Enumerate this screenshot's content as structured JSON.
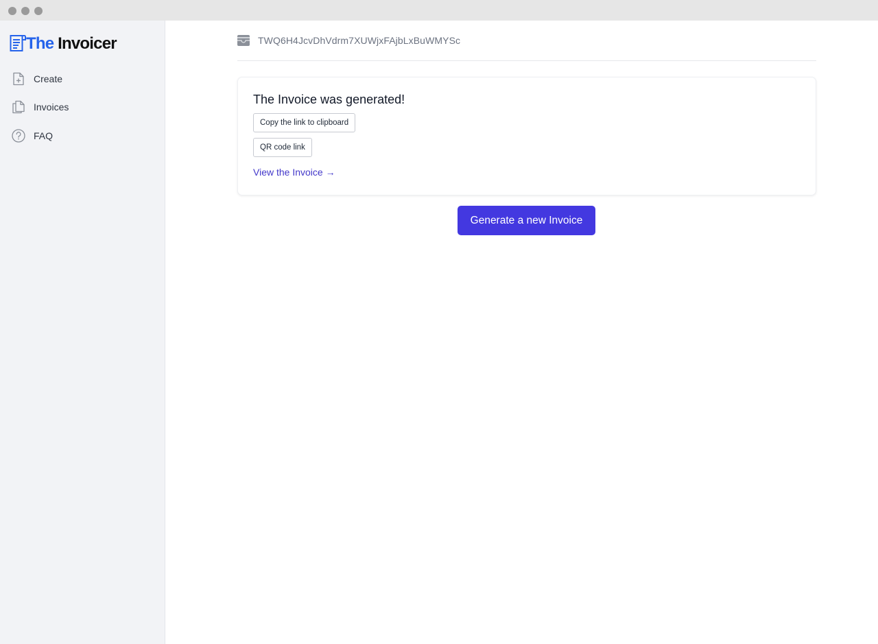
{
  "colors": {
    "accent": "#4338e0",
    "link": "#4338ca",
    "logo_accent": "#2563eb",
    "sidebar_bg": "#f2f3f6"
  },
  "app": {
    "logo_prefix": "The",
    "logo_suffix": "Invoicer",
    "logo_icon": "receipt-icon"
  },
  "sidebar": {
    "items": [
      {
        "label": "Create",
        "icon": "file-plus-icon"
      },
      {
        "label": "Invoices",
        "icon": "documents-icon"
      },
      {
        "label": "FAQ",
        "icon": "question-circle-icon"
      }
    ]
  },
  "header": {
    "wallet_icon": "wallet-icon",
    "address": "TWQ6H4JcvDhVdrm7XUWjxFAjbLxBuWMYSc"
  },
  "result": {
    "title": "The Invoice was generated!",
    "copy_link_label": "Copy the link to clipboard",
    "qr_link_label": "QR code link",
    "view_link_label": "View the Invoice →"
  },
  "actions": {
    "generate_new_label": "Generate a new Invoice"
  }
}
